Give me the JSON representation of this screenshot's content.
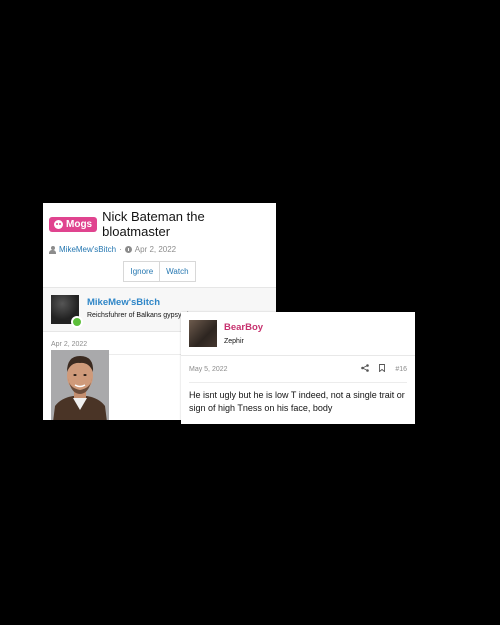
{
  "thread": {
    "prefix": "Mogs",
    "title": "Nick Bateman the bloatmaster",
    "author": "MikeMew'sBitch",
    "separator": "·",
    "date": "Apr 2, 2022",
    "ignore_label": "Ignore",
    "watch_label": "Watch"
  },
  "first_post": {
    "author_name": "MikeMew'sBitch",
    "author_title": "Reichsfuhrer of Balkans gypsy slums",
    "date": "Apr 2, 2022"
  },
  "reply_post": {
    "author_name": "BearBoy",
    "author_title": "Zephir",
    "date": "May 5, 2022",
    "post_number": "#16",
    "text": "He isnt ugly but he is low T indeed, not a single trait or sign of high Tness on his face, body"
  },
  "colors": {
    "prefix_bg": "#e0448f",
    "link": "#2577b1",
    "reply_username": "#c7326f",
    "online": "#5cbf3a"
  },
  "icons": [
    "skull-icon",
    "user-icon",
    "clock-icon",
    "share-icon",
    "bookmark-icon"
  ]
}
